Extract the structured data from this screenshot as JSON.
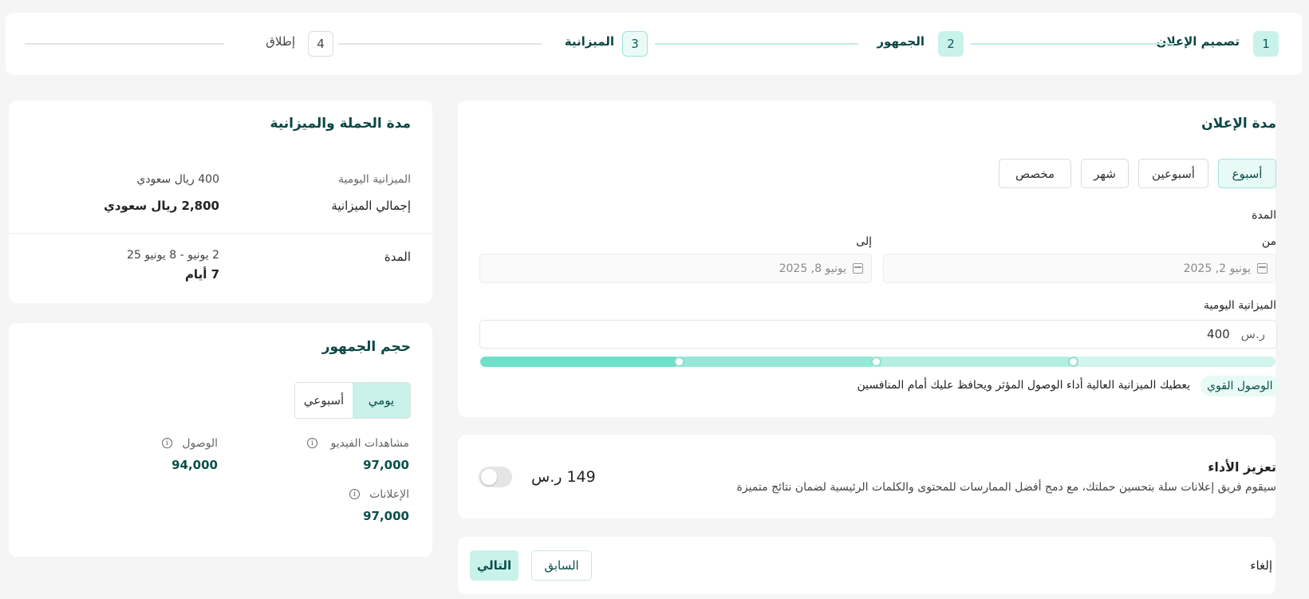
{
  "stepper": {
    "steps": [
      {
        "number": "1",
        "label": "تصميم الإعلان"
      },
      {
        "number": "2",
        "label": "الجمهور"
      },
      {
        "number": "3",
        "label": "الميزانية"
      },
      {
        "number": "4",
        "label": "إطلاق"
      }
    ]
  },
  "ad_duration": {
    "title": "مدة الإعلان",
    "presets": [
      "أسبوع",
      "أسبوعين",
      "شهر",
      "مخصص"
    ],
    "selected_preset": "أسبوع",
    "period_label": "المدة",
    "from_label": "من",
    "to_label": "إلى",
    "from_value": "يونيو 2, 2025",
    "to_value": "يونيو 8, 2025",
    "daily_budget_label": "الميزانية اليومية",
    "daily_budget_value": "400",
    "currency": "ر.س",
    "budget_level": 1.0,
    "reach_badge": "الوصول القوي",
    "reach_description": "يعطيك الميزانية العالية أداء الوصول المؤثر ويحافظ عليك أمام المنافسين",
    "colors": {
      "accent": "#6ee0c9",
      "accent_light": "#c9f2ea"
    }
  },
  "boost": {
    "title": "تعزيز الأداء",
    "description": "سيقوم فريق إعلانات سلة بتحسين حملتك، مع دمج أفضل الممارسات للمحتوى والكلمات الرئيسية لضمان نتائج متميزة",
    "price": "149 ر.س",
    "enabled": false
  },
  "actions": {
    "cancel": "إلغاء",
    "previous": "السابق",
    "next": "التالي"
  },
  "summary": {
    "title": "مدة الحملة والميزانية",
    "daily_budget_label": "الميزانية اليومية",
    "daily_budget_value": "400 ريال سعودي",
    "total_budget_label": "إجمالي الميزانية",
    "total_budget_value": "2,800 ريال سعودي",
    "duration_label": "المدة",
    "duration_range": "2 يونيو - 8 يونيو 25",
    "duration_days": "7 أيام"
  },
  "audience": {
    "title": "حجم الجمهور",
    "tabs": [
      "يومي",
      "أسبوعي"
    ],
    "selected_tab": "يومي",
    "metrics": [
      {
        "label": "مشاهدات الفيديو",
        "value": "97,000"
      },
      {
        "label": "الوصول",
        "value": "94,000"
      },
      {
        "label": "الإعلانات",
        "value": "97,000"
      }
    ]
  }
}
